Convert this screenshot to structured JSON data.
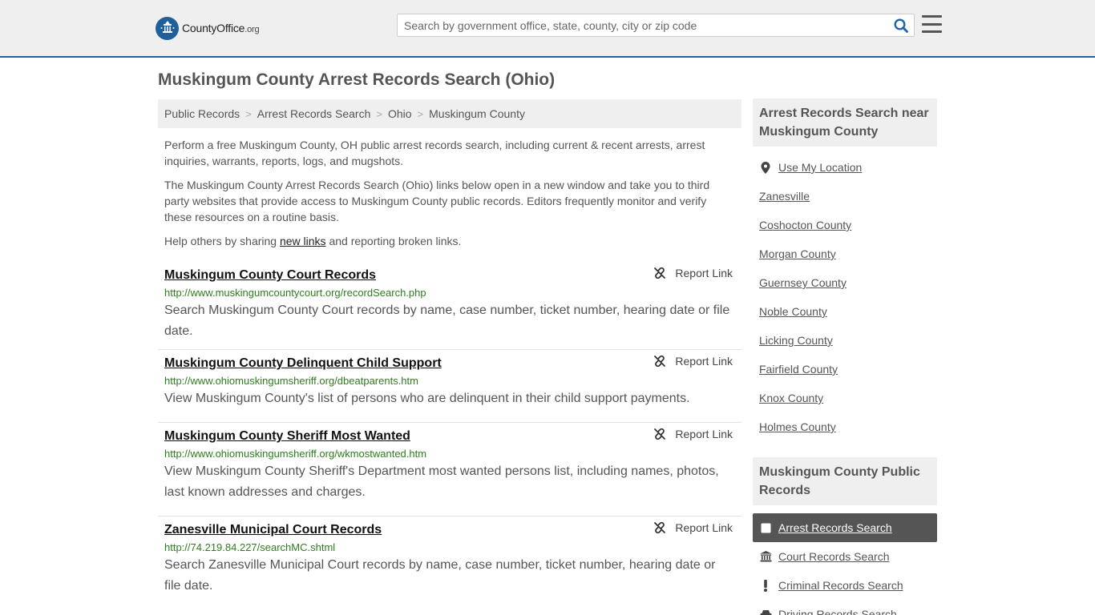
{
  "header": {
    "logo_name": "CountyOffice",
    "logo_tld": ".org",
    "search_placeholder": "Search by government office, state, county, city or zip code"
  },
  "page_title": "Muskingum County Arrest Records Search (Ohio)",
  "breadcrumb": [
    "Public Records",
    "Arrest Records Search",
    "Ohio",
    "Muskingum County"
  ],
  "intro": {
    "p1": "Perform a free Muskingum County, OH public arrest records search, including current & recent arrests, arrest inquiries, warrants, reports, logs, and mugshots.",
    "p2": "The Muskingum County Arrest Records Search (Ohio) links below open in a new window and take you to third party websites that provide access to Muskingum County public records. Editors frequently monitor and verify these resources on a routine basis.",
    "p3_before": "Help others by sharing ",
    "p3_link": "new links",
    "p3_after": " and reporting broken links."
  },
  "report_label": "Report Link",
  "records": [
    {
      "title": "Muskingum County Court Records",
      "url": "http://www.muskingumcountycourt.org/recordSearch.php",
      "desc": "Search Muskingum County Court records by name, case number, ticket number, hearing date or file date."
    },
    {
      "title": "Muskingum County Delinquent Child Support",
      "url": "http://www.ohiomuskingumsheriff.org/dbeatparents.htm",
      "desc": "View Muskingum County's list of persons who are delinquent in their child support payments."
    },
    {
      "title": "Muskingum County Sheriff Most Wanted",
      "url": "http://www.ohiomuskingumsheriff.org/wkmostwanted.htm",
      "desc": "View Muskingum County Sheriff's Department most wanted persons list, including names, photos, last known addresses and charges."
    },
    {
      "title": "Zanesville Municipal Court Records",
      "url": "http://74.219.84.227/searchMC.shtml",
      "desc": "Search Zanesville Municipal Court records by name, case number, ticket number, hearing date or file date."
    }
  ],
  "sidebar": {
    "nearby_title": "Arrest Records Search near Muskingum County",
    "use_location": "Use My Location",
    "nearby": [
      "Zanesville",
      "Coshocton County",
      "Morgan County",
      "Guernsey County",
      "Noble County",
      "Licking County",
      "Fairfield County",
      "Knox County",
      "Holmes County"
    ],
    "public_title": "Muskingum County Public Records",
    "public_records": [
      {
        "label": "Arrest Records Search",
        "icon": "checkbox-icon",
        "active": true
      },
      {
        "label": "Court Records Search",
        "icon": "courthouse-icon",
        "active": false
      },
      {
        "label": "Criminal Records Search",
        "icon": "exclamation-icon",
        "active": false
      },
      {
        "label": "Driving Records Search",
        "icon": "car-icon",
        "active": false
      }
    ]
  },
  "colors": {
    "accent": "#1f65a6",
    "url_green": "#2e7d1e",
    "panel_gray": "#efefef",
    "active_bg": "#555555"
  }
}
